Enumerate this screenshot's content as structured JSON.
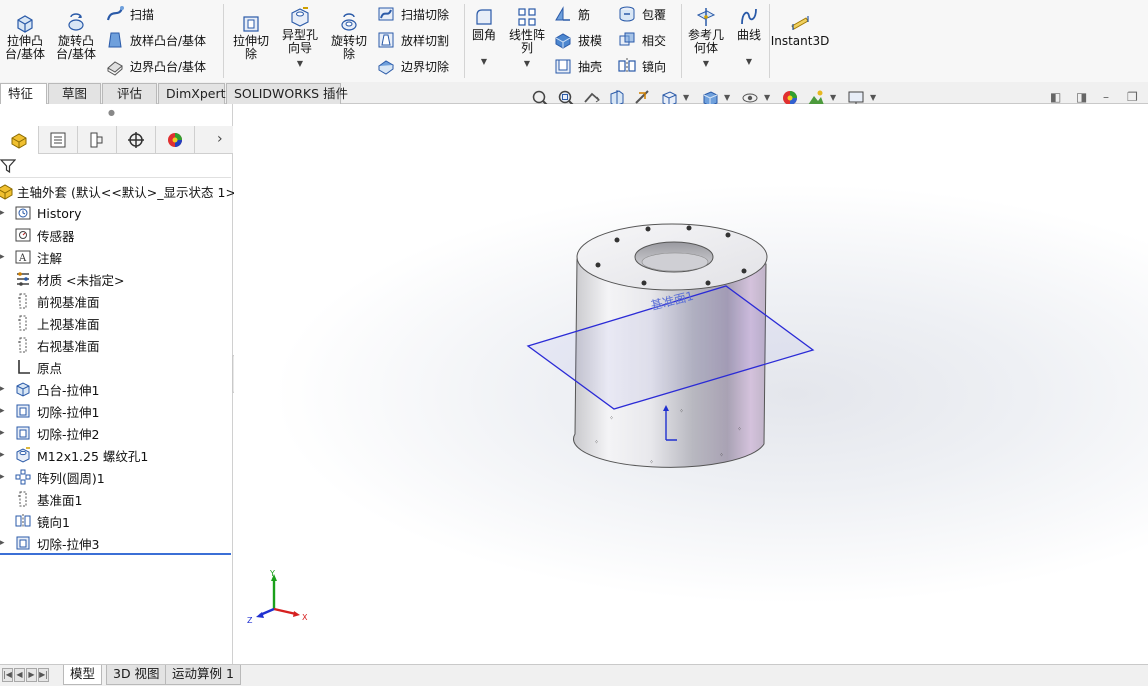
{
  "ribbon": {
    "extrude_boss": "拉伸凸\n台/基体",
    "revolve_boss": "旋转凸\n台/基体",
    "sweep": "扫描",
    "loft_boss": "放样凸台/基体",
    "boundary_boss": "边界凸台/基体",
    "extrude_cut": "拉伸切\n除",
    "hole_wizard": "异型孔\n向导",
    "revolve_cut": "旋转切\n除",
    "sweep_cut": "扫描切除",
    "loft_cut": "放样切割",
    "boundary_cut": "边界切除",
    "fillet": "圆角",
    "linear_pattern": "线性阵\n列",
    "rib": "筋",
    "draft": "拔模",
    "shell": "抽壳",
    "wrap": "包覆",
    "intersect": "相交",
    "mirror": "镜向",
    "ref_geometry": "参考几\n何体",
    "curves": "曲线",
    "instant3d": "Instant3D"
  },
  "tabs": [
    "特征",
    "草图",
    "评估",
    "DimXpert",
    "SOLIDWORKS 插件"
  ],
  "tree": {
    "root": "主轴外套 (默认<<默认>_显示状态 1>)",
    "items": [
      {
        "label": "History",
        "expandable": true,
        "icon": "history-icon"
      },
      {
        "label": "传感器",
        "expandable": false,
        "icon": "sensor-icon"
      },
      {
        "label": "注解",
        "expandable": true,
        "icon": "annotation-icon"
      },
      {
        "label": "材质 <未指定>",
        "expandable": false,
        "icon": "material-icon"
      },
      {
        "label": "前视基准面",
        "expandable": false,
        "icon": "plane-icon"
      },
      {
        "label": "上视基准面",
        "expandable": false,
        "icon": "plane-icon"
      },
      {
        "label": "右视基准面",
        "expandable": false,
        "icon": "plane-icon"
      },
      {
        "label": "原点",
        "expandable": false,
        "icon": "origin-icon"
      },
      {
        "label": "凸台-拉伸1",
        "expandable": true,
        "icon": "boss-extrude-icon"
      },
      {
        "label": "切除-拉伸1",
        "expandable": true,
        "icon": "cut-extrude-icon"
      },
      {
        "label": "切除-拉伸2",
        "expandable": true,
        "icon": "cut-extrude-icon"
      },
      {
        "label": "M12x1.25 螺纹孔1",
        "expandable": true,
        "icon": "hole-icon"
      },
      {
        "label": "阵列(圆周)1",
        "expandable": true,
        "icon": "circular-pattern-icon"
      },
      {
        "label": "基准面1",
        "expandable": false,
        "icon": "plane-icon"
      },
      {
        "label": "镜向1",
        "expandable": false,
        "icon": "mirror-feature-icon"
      },
      {
        "label": "切除-拉伸3",
        "expandable": true,
        "icon": "cut-extrude-icon"
      }
    ]
  },
  "viewport": {
    "plane_label": "基准面1",
    "triad": {
      "x": "X",
      "y": "Y",
      "z": "Z"
    }
  },
  "bottom_tabs": [
    "模型",
    "3D 视图",
    "运动算例 1"
  ],
  "colors": {
    "selection_blue": "#2b2bd6",
    "tree_end_line": "#3b6fd6",
    "triad_x": "#d62020",
    "triad_y": "#1aa01a",
    "triad_z": "#2030d0"
  }
}
